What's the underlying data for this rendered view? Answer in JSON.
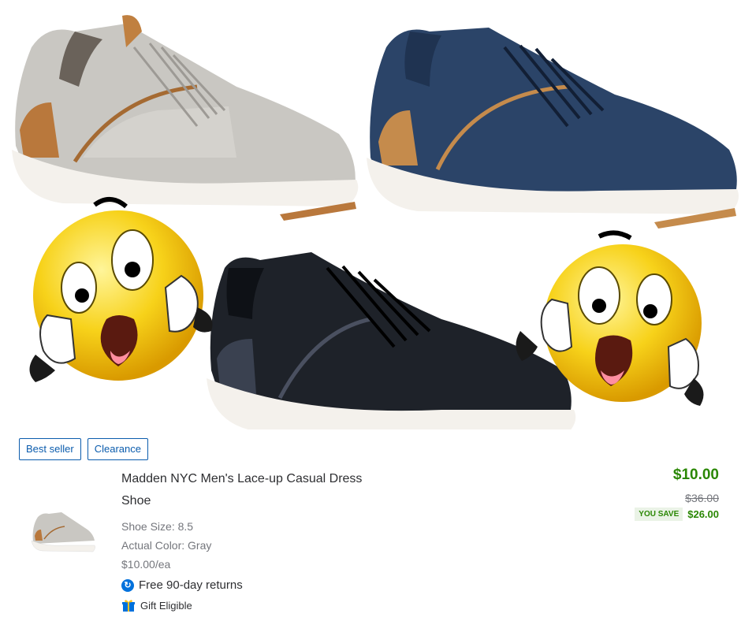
{
  "badges": {
    "best_seller": "Best seller",
    "clearance": "Clearance"
  },
  "product": {
    "title_line1": "Madden NYC Men's Lace-up Casual Dress",
    "title_line2": "Shoe",
    "size": "Shoe Size: 8.5",
    "color": "Actual Color: Gray",
    "unit_price": "$10.00/ea",
    "returns": "Free 90-day returns",
    "gift": "Gift Eligible"
  },
  "price": {
    "current": "$10.00",
    "was": "$36.00",
    "you_save_label": "YOU SAVE",
    "you_save_amount": "$26.00"
  },
  "colors": {
    "gray_shoe": "#c9c7c2",
    "navy_shoe": "#2b4468",
    "black_shoe": "#1e2229",
    "price_green": "#2a8703",
    "link_blue": "#0b5cad",
    "emoji_yellow": "#f7d21a"
  },
  "icons": {
    "returns": "return-arrow-icon",
    "gift": "gift-icon"
  }
}
